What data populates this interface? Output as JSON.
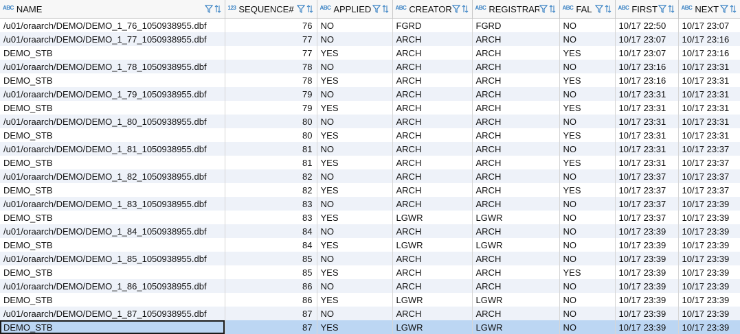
{
  "columns": [
    {
      "label": "NAME",
      "type_icon": "ABC"
    },
    {
      "label": "SEQUENCE#",
      "type_icon": "123"
    },
    {
      "label": "APPLIED",
      "type_icon": "ABC"
    },
    {
      "label": "CREATOR",
      "type_icon": "ABC"
    },
    {
      "label": "REGISTRAR",
      "type_icon": "ABC"
    },
    {
      "label": "FAL",
      "type_icon": "ABC"
    },
    {
      "label": "FIRST",
      "type_icon": "ABC"
    },
    {
      "label": "NEXT",
      "type_icon": "ABC"
    }
  ],
  "rows": [
    [
      "/u01/oraarch/DEMO/DEMO_1_76_1050938955.dbf",
      "76",
      "NO",
      "FGRD",
      "FGRD",
      "NO",
      "10/17 22:50",
      "10/17 23:07"
    ],
    [
      "/u01/oraarch/DEMO/DEMO_1_77_1050938955.dbf",
      "77",
      "NO",
      "ARCH",
      "ARCH",
      "NO",
      "10/17 23:07",
      "10/17 23:16"
    ],
    [
      "DEMO_STB",
      "77",
      "YES",
      "ARCH",
      "ARCH",
      "YES",
      "10/17 23:07",
      "10/17 23:16"
    ],
    [
      "/u01/oraarch/DEMO/DEMO_1_78_1050938955.dbf",
      "78",
      "NO",
      "ARCH",
      "ARCH",
      "NO",
      "10/17 23:16",
      "10/17 23:31"
    ],
    [
      "DEMO_STB",
      "78",
      "YES",
      "ARCH",
      "ARCH",
      "YES",
      "10/17 23:16",
      "10/17 23:31"
    ],
    [
      "/u01/oraarch/DEMO/DEMO_1_79_1050938955.dbf",
      "79",
      "NO",
      "ARCH",
      "ARCH",
      "NO",
      "10/17 23:31",
      "10/17 23:31"
    ],
    [
      "DEMO_STB",
      "79",
      "YES",
      "ARCH",
      "ARCH",
      "YES",
      "10/17 23:31",
      "10/17 23:31"
    ],
    [
      "/u01/oraarch/DEMO/DEMO_1_80_1050938955.dbf",
      "80",
      "NO",
      "ARCH",
      "ARCH",
      "NO",
      "10/17 23:31",
      "10/17 23:31"
    ],
    [
      "DEMO_STB",
      "80",
      "YES",
      "ARCH",
      "ARCH",
      "YES",
      "10/17 23:31",
      "10/17 23:31"
    ],
    [
      "/u01/oraarch/DEMO/DEMO_1_81_1050938955.dbf",
      "81",
      "NO",
      "ARCH",
      "ARCH",
      "NO",
      "10/17 23:31",
      "10/17 23:37"
    ],
    [
      "DEMO_STB",
      "81",
      "YES",
      "ARCH",
      "ARCH",
      "YES",
      "10/17 23:31",
      "10/17 23:37"
    ],
    [
      "/u01/oraarch/DEMO/DEMO_1_82_1050938955.dbf",
      "82",
      "NO",
      "ARCH",
      "ARCH",
      "NO",
      "10/17 23:37",
      "10/17 23:37"
    ],
    [
      "DEMO_STB",
      "82",
      "YES",
      "ARCH",
      "ARCH",
      "YES",
      "10/17 23:37",
      "10/17 23:37"
    ],
    [
      "/u01/oraarch/DEMO/DEMO_1_83_1050938955.dbf",
      "83",
      "NO",
      "ARCH",
      "ARCH",
      "NO",
      "10/17 23:37",
      "10/17 23:39"
    ],
    [
      "DEMO_STB",
      "83",
      "YES",
      "LGWR",
      "LGWR",
      "NO",
      "10/17 23:37",
      "10/17 23:39"
    ],
    [
      "/u01/oraarch/DEMO/DEMO_1_84_1050938955.dbf",
      "84",
      "NO",
      "ARCH",
      "ARCH",
      "NO",
      "10/17 23:39",
      "10/17 23:39"
    ],
    [
      "DEMO_STB",
      "84",
      "YES",
      "LGWR",
      "LGWR",
      "NO",
      "10/17 23:39",
      "10/17 23:39"
    ],
    [
      "/u01/oraarch/DEMO/DEMO_1_85_1050938955.dbf",
      "85",
      "NO",
      "ARCH",
      "ARCH",
      "NO",
      "10/17 23:39",
      "10/17 23:39"
    ],
    [
      "DEMO_STB",
      "85",
      "YES",
      "ARCH",
      "ARCH",
      "YES",
      "10/17 23:39",
      "10/17 23:39"
    ],
    [
      "/u01/oraarch/DEMO/DEMO_1_86_1050938955.dbf",
      "86",
      "NO",
      "ARCH",
      "ARCH",
      "NO",
      "10/17 23:39",
      "10/17 23:39"
    ],
    [
      "DEMO_STB",
      "86",
      "YES",
      "LGWR",
      "LGWR",
      "NO",
      "10/17 23:39",
      "10/17 23:39"
    ],
    [
      "/u01/oraarch/DEMO/DEMO_1_87_1050938955.dbf",
      "87",
      "NO",
      "ARCH",
      "ARCH",
      "NO",
      "10/17 23:39",
      "10/17 23:39"
    ],
    [
      "DEMO_STB",
      "87",
      "YES",
      "LGWR",
      "LGWR",
      "NO",
      "10/17 23:39",
      "10/17 23:39"
    ]
  ],
  "selected_row": 22,
  "icons": {
    "filter": "filter-icon",
    "sort": "sort-icon",
    "type": "column-type-icon"
  },
  "colors": {
    "accent": "#3b83c4",
    "row_stripe": "#eef2f9",
    "selection": "#bcd6f3"
  }
}
